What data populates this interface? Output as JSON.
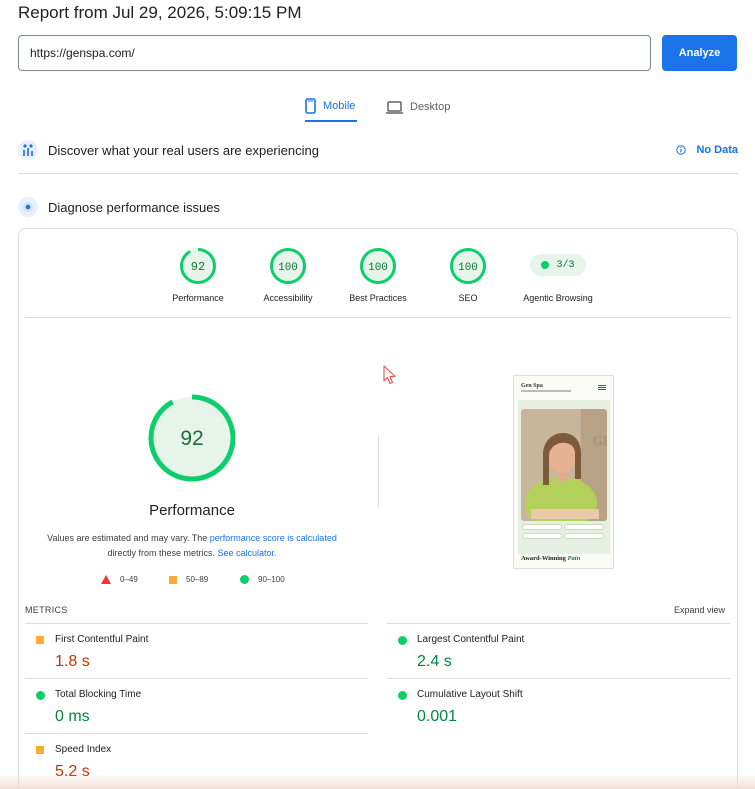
{
  "report": {
    "title": "Report from Jul 29, 2026, 5:09:15 PM"
  },
  "search": {
    "url": "https://genspa.com/",
    "analyze_label": "Analyze"
  },
  "tabs": [
    {
      "label": "Mobile",
      "active": true,
      "icon": "phone-icon"
    },
    {
      "label": "Desktop",
      "active": false,
      "icon": "laptop-icon"
    }
  ],
  "field_data": {
    "label": "Discover what your real users are experiencing",
    "status": "No Data"
  },
  "diagnose": {
    "label": "Diagnose performance issues"
  },
  "categories": [
    {
      "label": "Performance",
      "score": "92",
      "color": "#0cce6b"
    },
    {
      "label": "Accessibility",
      "score": "100",
      "color": "#0cce6b"
    },
    {
      "label": "Best Practices",
      "score": "100",
      "color": "#0cce6b"
    },
    {
      "label": "SEO",
      "score": "100",
      "color": "#0cce6b"
    },
    {
      "label": "Agentic Browsing",
      "score": "3/3",
      "color": "#0cce6b"
    }
  ],
  "performance": {
    "score": "92",
    "label": "Performance",
    "note_prefix": "Values are estimated and may vary. The ",
    "note_link1": "performance score is calculated",
    "note_mid": " directly from these metrics. ",
    "note_link2": "See calculator."
  },
  "legend": [
    {
      "range": "0–49",
      "color": "#ff3333"
    },
    {
      "range": "50–89",
      "color": "#ffaa33"
    },
    {
      "range": "90–100",
      "color": "#0cce6b"
    }
  ],
  "screenshot": {
    "brand": "Gen Spa",
    "headline": "Award-Winning",
    "headline_em": "Pain"
  },
  "metrics": {
    "header": "METRICS",
    "expand": "Expand view",
    "items": [
      {
        "name": "First Contentful Paint",
        "value": "1.8 s",
        "rating": "average"
      },
      {
        "name": "Largest Contentful Paint",
        "value": "2.4 s",
        "rating": "pass"
      },
      {
        "name": "Total Blocking Time",
        "value": "0 ms",
        "rating": "pass"
      },
      {
        "name": "Cumulative Layout Shift",
        "value": "0.001",
        "rating": "pass"
      },
      {
        "name": "Speed Index",
        "value": "5.2 s",
        "rating": "average"
      }
    ]
  }
}
